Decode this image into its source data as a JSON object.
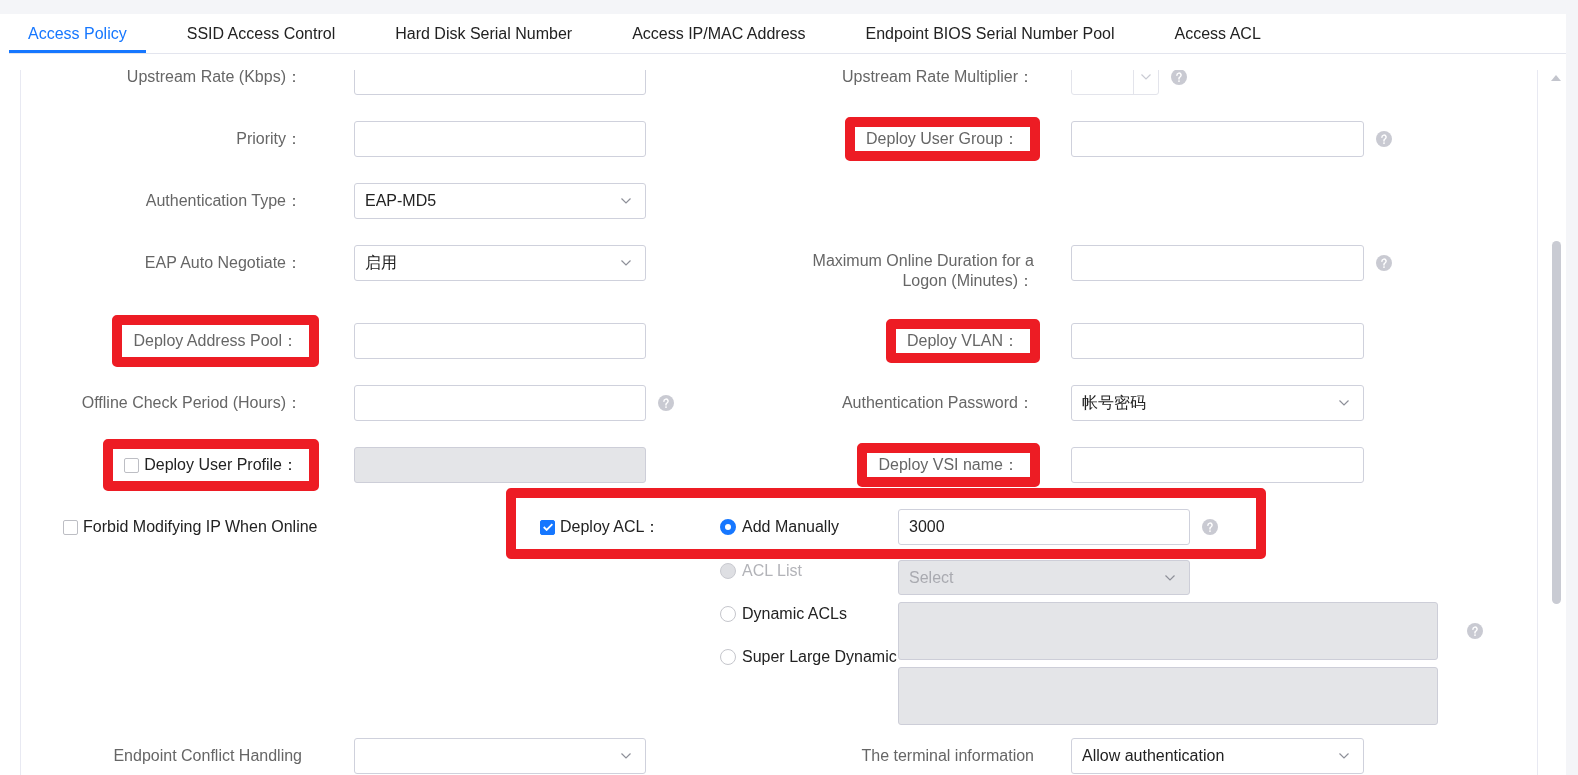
{
  "tabs": [
    {
      "label": "Access Policy",
      "selected": true
    },
    {
      "label": "SSID Access Control",
      "selected": false
    },
    {
      "label": "Hard Disk Serial Number",
      "selected": false
    },
    {
      "label": "Access IP/MAC Address",
      "selected": false
    },
    {
      "label": "Endpoint BIOS Serial Number Pool",
      "selected": false
    },
    {
      "label": "Access ACL",
      "selected": false
    }
  ],
  "form_rows": [
    {
      "left": {
        "label": "Upstream Rate (Kbps)：",
        "highlighted": false,
        "field": {
          "kind": "input",
          "disabled": false
        },
        "help": false
      },
      "right": {
        "label": "Upstream Rate Multiplier：",
        "highlighted": false,
        "field": {
          "kind": "spinner",
          "disabled": false
        },
        "help": true
      }
    },
    {
      "left": {
        "label": "Priority：",
        "highlighted": false,
        "field": {
          "kind": "input",
          "disabled": false
        },
        "help": false
      },
      "right": {
        "label": "Deploy User Group：",
        "highlighted": true,
        "field": {
          "kind": "input",
          "disabled": false
        },
        "help": true
      }
    },
    {
      "left": {
        "label": "Authentication Type：",
        "highlighted": false,
        "field": {
          "kind": "select",
          "value": "EAP-MD5",
          "disabled": false
        },
        "help": false
      }
    },
    {
      "left": {
        "label": "EAP Auto Negotiate：",
        "highlighted": false,
        "field": {
          "kind": "select",
          "value": "启用",
          "disabled": false
        },
        "help": false
      },
      "right": {
        "label": "Maximum Online Duration for a Logon (Minutes)：",
        "highlighted": false,
        "field": {
          "kind": "input",
          "disabled": false
        },
        "help": true
      }
    },
    {
      "left": {
        "label": "Deploy Address Pool：",
        "highlighted": true,
        "field": {
          "kind": "input",
          "disabled": false
        },
        "help": false
      },
      "right": {
        "label": "Deploy VLAN：",
        "highlighted": true,
        "field": {
          "kind": "input",
          "disabled": false
        },
        "help": false
      }
    },
    {
      "left": {
        "label": "Offline Check Period (Hours)：",
        "highlighted": false,
        "field": {
          "kind": "input",
          "disabled": false
        },
        "help": true
      },
      "right": {
        "label": "Authentication Password：",
        "highlighted": false,
        "field": {
          "kind": "select",
          "value": "帐号密码",
          "disabled": false
        },
        "help": false
      }
    },
    {
      "left": {
        "label": "Deploy User Profile：",
        "highlighted": true,
        "checkbox": {
          "checked": false
        },
        "field": {
          "kind": "input",
          "disabled": true
        },
        "help": false
      },
      "right": {
        "label": "Deploy VSI name：",
        "highlighted": true,
        "field": {
          "kind": "input",
          "disabled": false
        },
        "help": false
      }
    }
  ],
  "acl_row": {
    "forbid_modifying_ip": {
      "label": "Forbid Modifying IP When Online",
      "checked": false
    },
    "deploy_acl": {
      "label": "Deploy ACL：",
      "checked": true,
      "highlighted": true,
      "options": [
        {
          "label": "Add Manually",
          "selected": true,
          "disabled": false,
          "field": {
            "kind": "input",
            "value": "3000",
            "disabled": false
          },
          "help": true
        },
        {
          "label": "ACL List",
          "selected": false,
          "disabled": true,
          "field": {
            "kind": "select",
            "placeholder": "Select",
            "disabled": true
          },
          "help": false
        },
        {
          "label": "Dynamic ACLs",
          "selected": false,
          "disabled": false,
          "field": {
            "kind": "textarea",
            "disabled": true
          },
          "help": true
        },
        {
          "label": "Super Large Dynamic",
          "selected": false,
          "disabled": false,
          "field": {
            "kind": "textarea",
            "disabled": true
          },
          "help": false
        }
      ]
    }
  },
  "rows_below": [
    {
      "left": {
        "label": "Endpoint Conflict Handling",
        "highlighted": false,
        "field": {
          "kind": "select",
          "disabled": false
        },
        "help": false
      },
      "right": {
        "label": "The terminal information",
        "highlighted": false,
        "field": {
          "kind": "select",
          "value": "Allow authentication",
          "disabled": false
        },
        "help": false
      }
    }
  ]
}
